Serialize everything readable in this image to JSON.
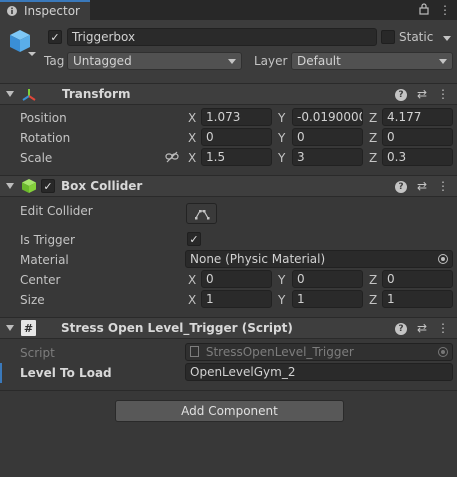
{
  "tab": {
    "title": "Inspector",
    "lock_icon": "lock-icon",
    "menu_icon": "kebab-menu-icon"
  },
  "object": {
    "name": "Triggerbox",
    "static_label": "Static",
    "tag_label": "Tag",
    "tag_value": "Untagged",
    "layer_label": "Layer",
    "layer_value": "Default"
  },
  "transform": {
    "title": "Transform",
    "labels": {
      "position": "Position",
      "rotation": "Rotation",
      "scale": "Scale"
    },
    "axes": {
      "x": "X",
      "y": "Y",
      "z": "Z"
    },
    "position": {
      "x": "1.073",
      "y": "-0.0190000",
      "z": "4.177"
    },
    "rotation": {
      "x": "0",
      "y": "0",
      "z": "0"
    },
    "scale": {
      "x": "1.5",
      "y": "3",
      "z": "0.3"
    }
  },
  "box_collider": {
    "title": "Box Collider",
    "labels": {
      "edit_collider": "Edit Collider",
      "is_trigger": "Is Trigger",
      "material": "Material",
      "center": "Center",
      "size": "Size"
    },
    "is_trigger_checked": "✓",
    "material_value": "None (Physic Material)",
    "center": {
      "x": "0",
      "y": "0",
      "z": "0"
    },
    "size": {
      "x": "1",
      "y": "1",
      "z": "1"
    }
  },
  "script": {
    "title": "Stress Open Level_Trigger (Script)",
    "labels": {
      "script": "Script",
      "level_to_load": "Level To Load"
    },
    "script_value": "StressOpenLevel_Trigger",
    "level_to_load_value": "OpenLevelGym_2"
  },
  "add_component": "Add Component",
  "colors": {
    "background": "#383838",
    "header": "#3e3e3e",
    "field": "#2a2a2a",
    "accent": "#3a79bb",
    "collider_icon": "#7fd13a"
  }
}
